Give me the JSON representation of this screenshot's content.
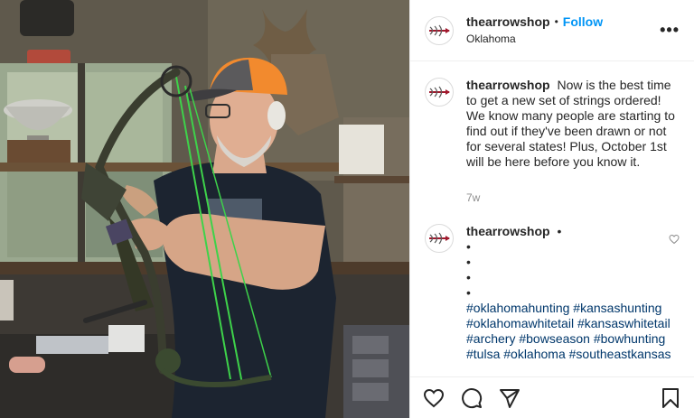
{
  "post": {
    "username": "thearrowshop",
    "follow_label": "Follow",
    "dot": "•",
    "location": "Oklahoma",
    "more_label": "•••",
    "photo_alt": "Man in orange cap stringing a compound bow in an archery shop"
  },
  "caption": {
    "username": "thearrowshop",
    "text": "Now is the best time to get a new set of strings ordered! We know many people are starting to find out if they've been drawn or not for several states! Plus, October 1st will be here before you know it.",
    "time": "7w"
  },
  "comment": {
    "username": "thearrowshop",
    "dot": "•",
    "bullets": [
      "•",
      "•",
      "•",
      "•"
    ],
    "hashtags": "#oklahomahunting #kansashunting #oklahomawhitetail #kansaswhitetail #archery #bowseason #bowhunting #tulsa #oklahoma #southeastkansas"
  },
  "icons": {
    "like": "heart-icon",
    "comment": "comment-icon",
    "share": "paper-plane-icon",
    "save": "bookmark-icon",
    "comment_like": "small-heart-icon"
  },
  "colors": {
    "follow": "#0095f6",
    "hashtag": "#00376b",
    "muted": "#8e8e8e",
    "cap_orange": "#f28a2e",
    "bow_string": "#3ed24a"
  }
}
